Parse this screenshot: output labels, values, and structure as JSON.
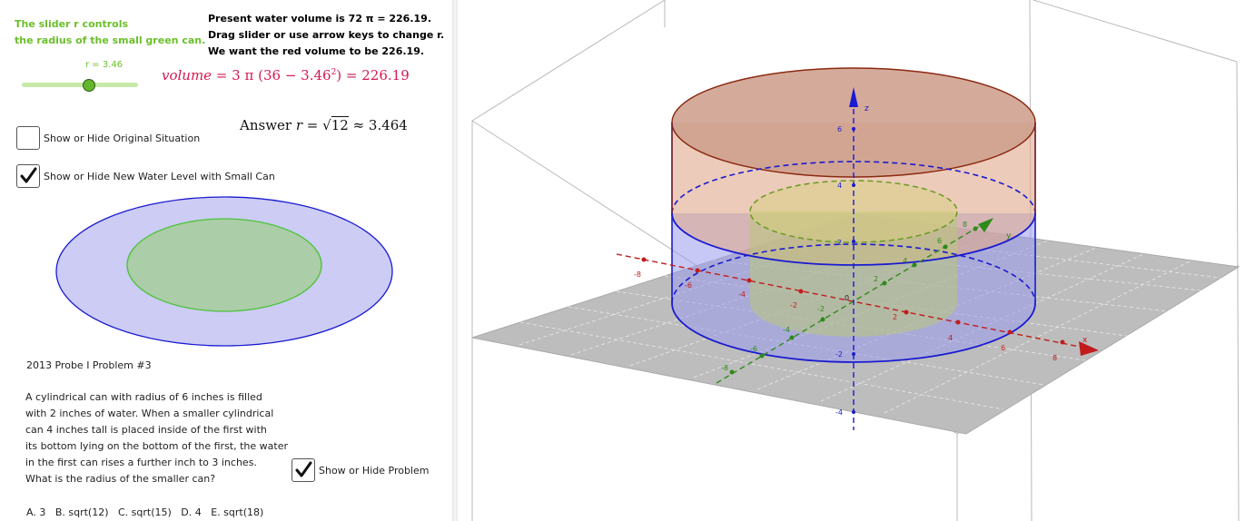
{
  "slider_info": {
    "line1": "The slider r controls",
    "line2": "the radius of the small green can."
  },
  "status": {
    "line1": "Present water volume is 72 π = 226.19.",
    "line2": "Drag slider or use arrow keys to change r.",
    "line3": "We want the red volume to be 226.19."
  },
  "slider": {
    "label": "r = 3.46",
    "value": 3.46,
    "min": 0,
    "max": 6
  },
  "formula": {
    "lhs": "volume",
    "eq": " = 3 π (36 − 3.46",
    "sup": "2",
    "rhs": ") = 226.19"
  },
  "answer": {
    "prefix": "Answer ",
    "var": "r",
    "eq": " = ",
    "sqrt": "√",
    "radicand": "12",
    "approx": " ≈ 3.464"
  },
  "checkboxes": {
    "original": {
      "label": "Show or Hide Original Situation",
      "checked": false
    },
    "new_level": {
      "label": "Show or Hide New Water Level with Small Can",
      "checked": true
    },
    "problem": {
      "label": "Show or Hide Problem",
      "checked": true
    }
  },
  "problem": {
    "title": "2013 Probe I Problem #3",
    "lines": [
      "A cylindrical can with radius of 6 inches is filled",
      "with 2 inches of water. When a smaller cylindrical",
      "can 4 inches tall is placed inside of the first with",
      "its bottom lying on the bottom of the first, the water",
      "in the first can rises a further inch to 3 inches.",
      "What is the radius of the smaller can?"
    ],
    "choices": "A. 3   B. sqrt(12)   C. sqrt(15)   D. 4   E. sqrt(18)"
  },
  "axes3d": {
    "x_label": "x",
    "y_label": "y",
    "z_label": "z",
    "z_ticks": [
      "6",
      "4",
      "2",
      "-2",
      "-4"
    ],
    "x_ticks": [
      "-8",
      "-6",
      "-4",
      "-2",
      "2",
      "4",
      "6",
      "8"
    ],
    "y_ticks": [
      "-8",
      "-6",
      "-4",
      "-2",
      "2",
      "4",
      "6",
      "8"
    ],
    "origin": "0"
  },
  "colors": {
    "green": "#6bbf2a",
    "blue": "#1a1ad0",
    "red_formula": "#d6184f",
    "can_brown": "#8b2a12"
  }
}
